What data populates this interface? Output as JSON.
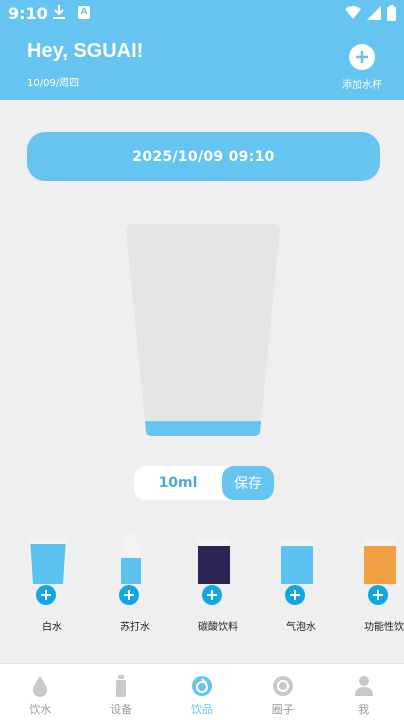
{
  "status": {
    "time": "9:10",
    "app_icon_letter": "A"
  },
  "header": {
    "greeting": "Hey, SGUAI!",
    "date": "10/09/周四",
    "add_cup_label": "添加水杯"
  },
  "datetime": "2025/10/09 09:10",
  "cup": {
    "fill_ratio": 0.07,
    "color_empty": "#e4e5e7",
    "color_water": "#65c4f0"
  },
  "amount": {
    "value": "10ml",
    "save_label": "保存"
  },
  "drinks": [
    {
      "name": "白水",
      "icon": "cup-icon",
      "color": "#5bc2f1"
    },
    {
      "name": "苏打水",
      "icon": "bottle-icon",
      "color": "#5bc2f1"
    },
    {
      "name": "碳酸饮料",
      "icon": "can-icon",
      "color": "#2d2553"
    },
    {
      "name": "气泡水",
      "icon": "can-icon",
      "color": "#5bc2f1"
    },
    {
      "name": "功能性饮",
      "icon": "can-icon",
      "color": "#f0a040"
    }
  ],
  "tabs": [
    {
      "label": "饮水",
      "icon": "water-drop-icon",
      "active": false
    },
    {
      "label": "设备",
      "icon": "bottle-device-icon",
      "active": false
    },
    {
      "label": "饮品",
      "icon": "drinks-icon",
      "active": true
    },
    {
      "label": "圈子",
      "icon": "circle-icon",
      "active": false
    },
    {
      "label": "我",
      "icon": "person-icon",
      "active": false
    }
  ],
  "colors": {
    "primary": "#65c4f0",
    "accent": "#11a7e6",
    "background": "#efefef"
  }
}
